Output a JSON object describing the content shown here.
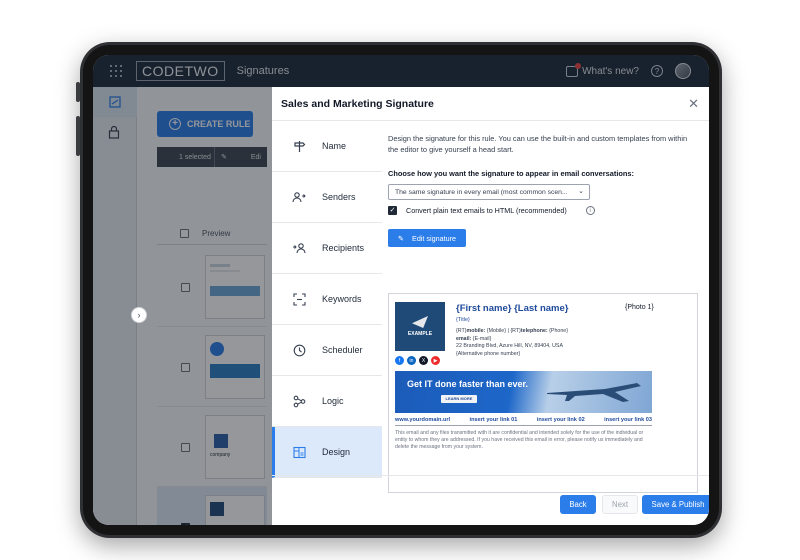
{
  "topbar": {
    "logo": "CODETWO",
    "app_title": "Signatures",
    "whats_new": "What's new?",
    "help": "?"
  },
  "background": {
    "create_rule": "CREATE RULE",
    "selected": "1 selected",
    "edit": "Edi",
    "preview_header": "Preview",
    "thumb_company": "company"
  },
  "modal": {
    "title": "Sales and Marketing Signature",
    "steps": [
      {
        "label": "Name",
        "icon": "signpost-icon"
      },
      {
        "label": "Senders",
        "icon": "senders-icon"
      },
      {
        "label": "Recipients",
        "icon": "recipients-icon"
      },
      {
        "label": "Keywords",
        "icon": "keywords-icon"
      },
      {
        "label": "Scheduler",
        "icon": "clock-icon"
      },
      {
        "label": "Logic",
        "icon": "logic-icon"
      },
      {
        "label": "Design",
        "icon": "design-icon"
      }
    ],
    "active_step": "Design",
    "intro": "Design the signature for this rule. You can use the built-in and custom templates from within the editor to give yourself a head start.",
    "choose_label": "Choose how you want the signature to appear in email conversations:",
    "select_value": "The same signature in every email (most common scen...",
    "convert_label": "Convert plain text emails to HTML (recommended)",
    "convert_checked": true,
    "edit_signature": "Edit signature",
    "footer": {
      "back": "Back",
      "next": "Next",
      "publish": "Save & Publish"
    }
  },
  "signature": {
    "logo_text": "EXAMPLE",
    "name": "{First name} {Last name}",
    "photo": "{Photo 1}",
    "title": "{Title}",
    "line1_prefix": "{RT}",
    "line1_mobile_label": "mobile:",
    "line1_mobile": "{Mobile}",
    "line1_sep": "|",
    "line1_tel_prefix": "{RT}",
    "line1_tel_label": "telephone:",
    "line1_tel": "{Phone}",
    "email_label": "email:",
    "email": "{E-mail}",
    "address": "22 Branding Blvd, Azure Hill, NV, 89404, USA",
    "alt_phone": "{Alternative phone number}",
    "socials": [
      "f",
      "in",
      "X",
      "▶"
    ],
    "banner_text_pre": "Get ",
    "banner_text_bold": "IT",
    "banner_text_post": " done faster than ever.",
    "banner_button": "LEARN MORE",
    "links": [
      "www.yourdomain.url",
      "insert your link 01",
      "insert your link 02",
      "insert your link 03"
    ],
    "disclaimer": "This email and any files transmitted with it are confidential and intended solely for the use of the individual or entity to whom they are addressed. If you have received this email in error, please notify us immediately and delete the message from your system."
  },
  "colors": {
    "accent": "#2b7de9",
    "topbar": "#1c2a3d",
    "signature_blue": "#1f4a9c"
  }
}
